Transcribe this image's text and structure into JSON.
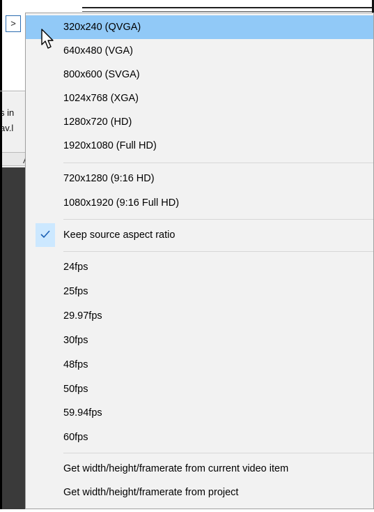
{
  "background": {
    "expander_label": ">",
    "text_line_1": "s in",
    "text_line_2": "av.l",
    "tab_label": "A"
  },
  "menu": {
    "items": [
      {
        "label": "320x240 (QVGA)",
        "highlighted": true
      },
      {
        "label": "640x480 (VGA)"
      },
      {
        "label": "800x600 (SVGA)"
      },
      {
        "label": "1024x768 (XGA)"
      },
      {
        "label": "1280x720 (HD)"
      },
      {
        "label": "1920x1080 (Full HD)"
      },
      {
        "label": "720x1280 (9:16 HD)"
      },
      {
        "label": "1080x1920 (9:16 Full HD)"
      },
      {
        "label": "Keep source aspect ratio",
        "checked": true
      },
      {
        "label": "24fps"
      },
      {
        "label": "25fps"
      },
      {
        "label": "29.97fps"
      },
      {
        "label": "30fps"
      },
      {
        "label": "48fps"
      },
      {
        "label": "50fps"
      },
      {
        "label": "59.94fps"
      },
      {
        "label": "60fps"
      },
      {
        "label": "Get width/height/framerate from current video item"
      },
      {
        "label": "Get width/height/framerate from project"
      }
    ]
  },
  "colors": {
    "highlight": "#91c9f7",
    "check_background": "#cce8ff",
    "check_mark": "#1a5fb4"
  }
}
